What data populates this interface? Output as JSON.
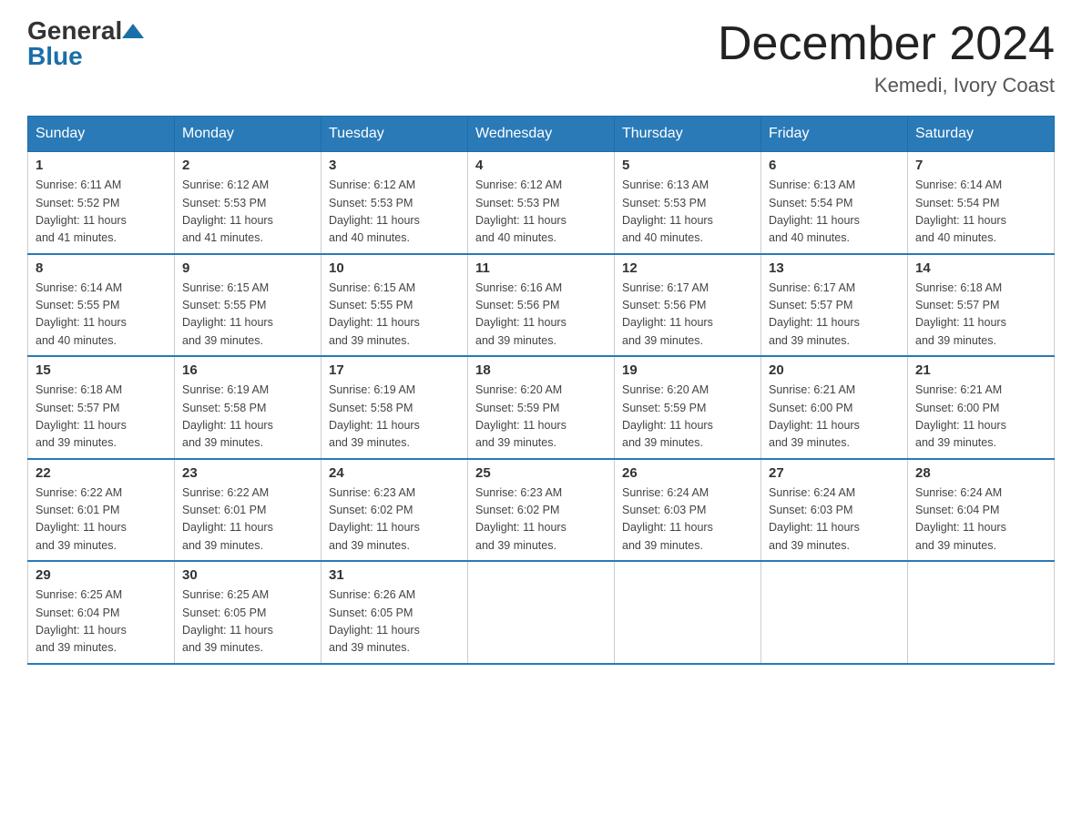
{
  "header": {
    "title": "December 2024",
    "subtitle": "Kemedi, Ivory Coast"
  },
  "logo": {
    "line1": "General",
    "line2": "Blue"
  },
  "days_of_week": [
    "Sunday",
    "Monday",
    "Tuesday",
    "Wednesday",
    "Thursday",
    "Friday",
    "Saturday"
  ],
  "weeks": [
    [
      {
        "date": "1",
        "sunrise": "6:11 AM",
        "sunset": "5:52 PM",
        "daylight": "11 hours and 41 minutes."
      },
      {
        "date": "2",
        "sunrise": "6:12 AM",
        "sunset": "5:53 PM",
        "daylight": "11 hours and 41 minutes."
      },
      {
        "date": "3",
        "sunrise": "6:12 AM",
        "sunset": "5:53 PM",
        "daylight": "11 hours and 40 minutes."
      },
      {
        "date": "4",
        "sunrise": "6:12 AM",
        "sunset": "5:53 PM",
        "daylight": "11 hours and 40 minutes."
      },
      {
        "date": "5",
        "sunrise": "6:13 AM",
        "sunset": "5:53 PM",
        "daylight": "11 hours and 40 minutes."
      },
      {
        "date": "6",
        "sunrise": "6:13 AM",
        "sunset": "5:54 PM",
        "daylight": "11 hours and 40 minutes."
      },
      {
        "date": "7",
        "sunrise": "6:14 AM",
        "sunset": "5:54 PM",
        "daylight": "11 hours and 40 minutes."
      }
    ],
    [
      {
        "date": "8",
        "sunrise": "6:14 AM",
        "sunset": "5:55 PM",
        "daylight": "11 hours and 40 minutes."
      },
      {
        "date": "9",
        "sunrise": "6:15 AM",
        "sunset": "5:55 PM",
        "daylight": "11 hours and 39 minutes."
      },
      {
        "date": "10",
        "sunrise": "6:15 AM",
        "sunset": "5:55 PM",
        "daylight": "11 hours and 39 minutes."
      },
      {
        "date": "11",
        "sunrise": "6:16 AM",
        "sunset": "5:56 PM",
        "daylight": "11 hours and 39 minutes."
      },
      {
        "date": "12",
        "sunrise": "6:17 AM",
        "sunset": "5:56 PM",
        "daylight": "11 hours and 39 minutes."
      },
      {
        "date": "13",
        "sunrise": "6:17 AM",
        "sunset": "5:57 PM",
        "daylight": "11 hours and 39 minutes."
      },
      {
        "date": "14",
        "sunrise": "6:18 AM",
        "sunset": "5:57 PM",
        "daylight": "11 hours and 39 minutes."
      }
    ],
    [
      {
        "date": "15",
        "sunrise": "6:18 AM",
        "sunset": "5:57 PM",
        "daylight": "11 hours and 39 minutes."
      },
      {
        "date": "16",
        "sunrise": "6:19 AM",
        "sunset": "5:58 PM",
        "daylight": "11 hours and 39 minutes."
      },
      {
        "date": "17",
        "sunrise": "6:19 AM",
        "sunset": "5:58 PM",
        "daylight": "11 hours and 39 minutes."
      },
      {
        "date": "18",
        "sunrise": "6:20 AM",
        "sunset": "5:59 PM",
        "daylight": "11 hours and 39 minutes."
      },
      {
        "date": "19",
        "sunrise": "6:20 AM",
        "sunset": "5:59 PM",
        "daylight": "11 hours and 39 minutes."
      },
      {
        "date": "20",
        "sunrise": "6:21 AM",
        "sunset": "6:00 PM",
        "daylight": "11 hours and 39 minutes."
      },
      {
        "date": "21",
        "sunrise": "6:21 AM",
        "sunset": "6:00 PM",
        "daylight": "11 hours and 39 minutes."
      }
    ],
    [
      {
        "date": "22",
        "sunrise": "6:22 AM",
        "sunset": "6:01 PM",
        "daylight": "11 hours and 39 minutes."
      },
      {
        "date": "23",
        "sunrise": "6:22 AM",
        "sunset": "6:01 PM",
        "daylight": "11 hours and 39 minutes."
      },
      {
        "date": "24",
        "sunrise": "6:23 AM",
        "sunset": "6:02 PM",
        "daylight": "11 hours and 39 minutes."
      },
      {
        "date": "25",
        "sunrise": "6:23 AM",
        "sunset": "6:02 PM",
        "daylight": "11 hours and 39 minutes."
      },
      {
        "date": "26",
        "sunrise": "6:24 AM",
        "sunset": "6:03 PM",
        "daylight": "11 hours and 39 minutes."
      },
      {
        "date": "27",
        "sunrise": "6:24 AM",
        "sunset": "6:03 PM",
        "daylight": "11 hours and 39 minutes."
      },
      {
        "date": "28",
        "sunrise": "6:24 AM",
        "sunset": "6:04 PM",
        "daylight": "11 hours and 39 minutes."
      }
    ],
    [
      {
        "date": "29",
        "sunrise": "6:25 AM",
        "sunset": "6:04 PM",
        "daylight": "11 hours and 39 minutes."
      },
      {
        "date": "30",
        "sunrise": "6:25 AM",
        "sunset": "6:05 PM",
        "daylight": "11 hours and 39 minutes."
      },
      {
        "date": "31",
        "sunrise": "6:26 AM",
        "sunset": "6:05 PM",
        "daylight": "11 hours and 39 minutes."
      },
      null,
      null,
      null,
      null
    ]
  ],
  "labels": {
    "sunrise": "Sunrise:",
    "sunset": "Sunset:",
    "daylight": "Daylight:"
  }
}
